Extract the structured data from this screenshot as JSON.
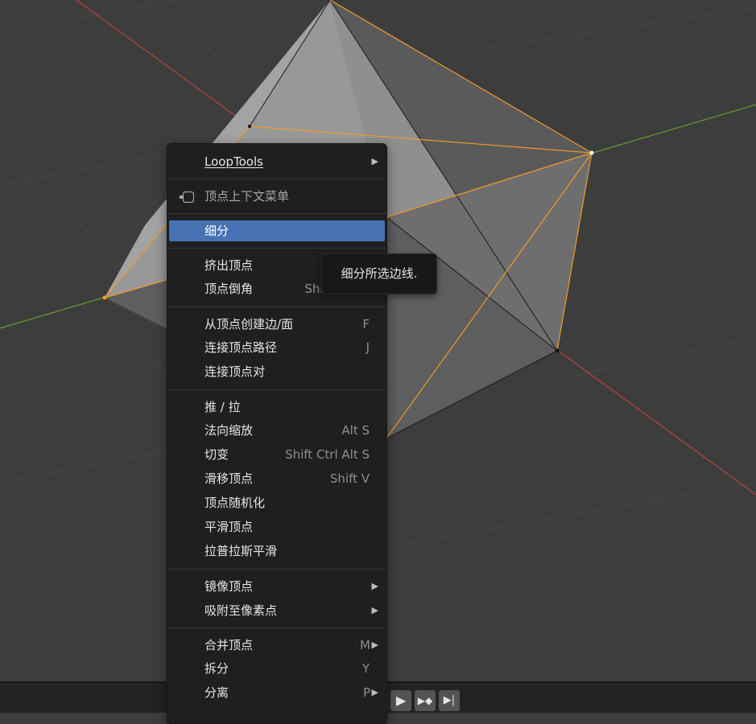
{
  "colors": {
    "viewport_bg": "#3d3d3d",
    "menu_bg": "#1f1f1f",
    "highlight": "#4772b3",
    "x_axis": "#c04040",
    "y_axis": "#6a9a2c",
    "selection_orange": "#f09a2a"
  },
  "menu": {
    "items": [
      {
        "label": "LoopTools",
        "shortcut": "",
        "submenu": true
      },
      {
        "label": "顶点上下文菜单",
        "icon": "context-menu-icon"
      },
      {
        "label": "细分",
        "shortcut": "",
        "highlighted": true
      },
      {
        "label": "挤出顶点",
        "shortcut": ""
      },
      {
        "label": "顶点倒角",
        "shortcut": "Shift Ctrl B"
      },
      {
        "label": "从顶点创建边/面",
        "shortcut": "F"
      },
      {
        "label": "连接顶点路径",
        "shortcut": "J"
      },
      {
        "label": "连接顶点对",
        "shortcut": ""
      },
      {
        "label": "推 / 拉",
        "shortcut": ""
      },
      {
        "label": "法向缩放",
        "shortcut": "Alt S"
      },
      {
        "label": "切变",
        "shortcut": "Shift Ctrl Alt S"
      },
      {
        "label": "滑移顶点",
        "shortcut": "Shift V"
      },
      {
        "label": "顶点随机化",
        "shortcut": ""
      },
      {
        "label": "平滑顶点",
        "shortcut": ""
      },
      {
        "label": "拉普拉斯平滑",
        "shortcut": ""
      },
      {
        "label": "镜像顶点",
        "shortcut": "",
        "submenu": true
      },
      {
        "label": "吸附至像素点",
        "shortcut": "",
        "submenu": true
      },
      {
        "label": "合并顶点",
        "shortcut": "M",
        "submenu": true
      },
      {
        "label": "拆分",
        "shortcut": "Y"
      },
      {
        "label": "分离",
        "shortcut": "P",
        "submenu": true
      }
    ],
    "submenu_arrow": "▶"
  },
  "tooltip": {
    "text": "细分所选边线."
  },
  "timeline": {
    "buttons": [
      {
        "name": "jump-start-icon",
        "glyph": "⏮"
      },
      {
        "name": "prev-keyframe-icon",
        "glyph": "◆"
      },
      {
        "name": "play-reverse-icon",
        "glyph": "◀"
      },
      {
        "name": "play-icon",
        "glyph": "▶"
      },
      {
        "name": "next-keyframe-icon",
        "glyph": "▶◆"
      },
      {
        "name": "jump-end-icon",
        "glyph": "▶|"
      }
    ]
  }
}
